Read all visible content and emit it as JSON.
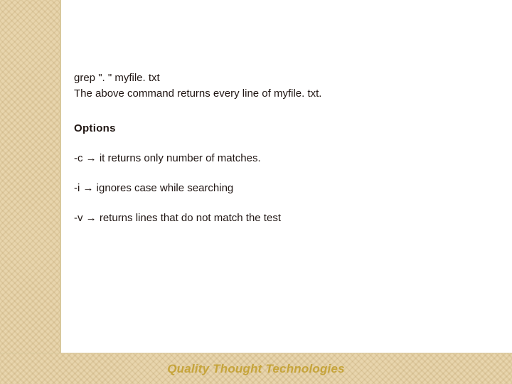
{
  "slide": {
    "command": "grep \". \" myfile. txt",
    "explain": "The above command returns every line of myfile. txt.",
    "options_heading": "Options",
    "options": [
      {
        "flag": "-c",
        "arrow": "→",
        "desc": "it returns only number of matches."
      },
      {
        "flag": "-i",
        "arrow": "→",
        "desc": "ignores case while searching"
      },
      {
        "flag": "-v",
        "arrow": "→",
        "desc": "returns lines that do not match the test"
      }
    ]
  },
  "footer": {
    "brand": "Quality Thought Technologies"
  }
}
